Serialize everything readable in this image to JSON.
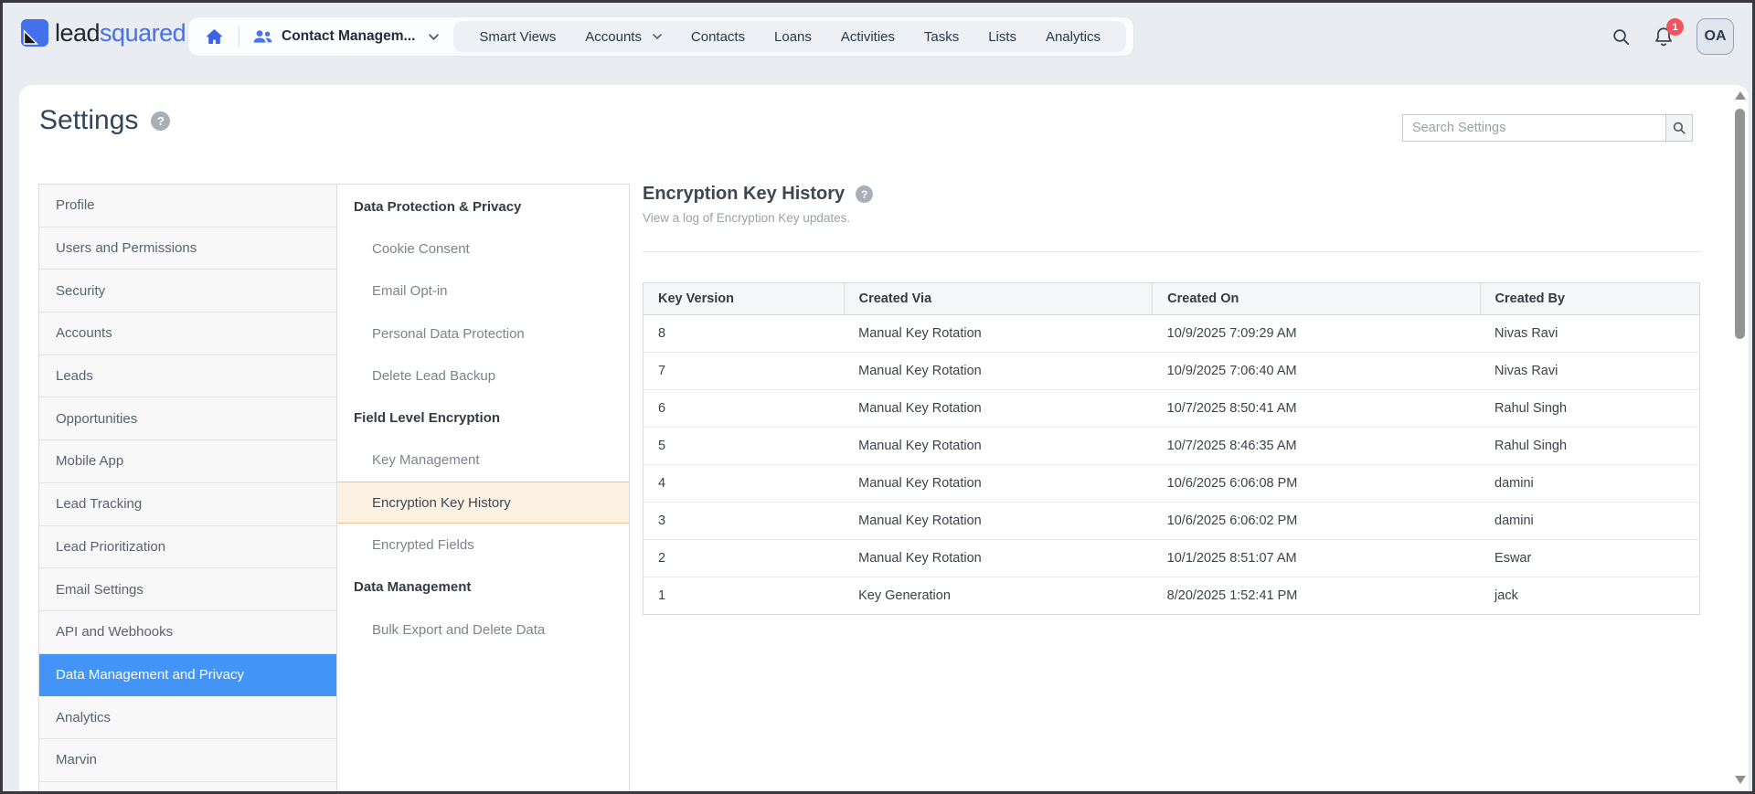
{
  "topbar": {
    "logo_lead": "lead",
    "logo_squared": "squared",
    "workspace_label": "Contact Managem...",
    "nav_items": [
      "Smart Views",
      "Accounts",
      "Contacts",
      "Loans",
      "Activities",
      "Tasks",
      "Lists",
      "Analytics"
    ],
    "nav_items_with_dropdown": [
      "Accounts"
    ],
    "notification_count": "1",
    "avatar_initials": "OA"
  },
  "icons": {
    "help_glyph": "?"
  },
  "page": {
    "title": "Settings",
    "search_placeholder": "Search Settings"
  },
  "sidebar": {
    "selected": "Data Management and Privacy",
    "items": [
      "Profile",
      "Users and Permissions",
      "Security",
      "Accounts",
      "Leads",
      "Opportunities",
      "Mobile App",
      "Lead Tracking",
      "Lead Prioritization",
      "Email Settings",
      "API and Webhooks",
      "Data Management and Privacy",
      "Analytics",
      "Marvin"
    ]
  },
  "subnav": {
    "selected": "Encryption Key History",
    "sections": [
      {
        "header": "Data Protection & Privacy",
        "items": [
          "Cookie Consent",
          "Email Opt-in",
          "Personal Data Protection",
          "Delete Lead Backup"
        ]
      },
      {
        "header": "Field Level Encryption",
        "items": [
          "Key Management",
          "Encryption Key History",
          "Encrypted Fields"
        ]
      },
      {
        "header": "Data Management",
        "items": [
          "Bulk Export and Delete Data"
        ]
      }
    ]
  },
  "content": {
    "title": "Encryption Key History",
    "subtitle": "View a log of Encryption Key updates.",
    "table": {
      "columns": [
        "Key Version",
        "Created Via",
        "Created On",
        "Created By"
      ],
      "rows": [
        [
          "8",
          "Manual Key Rotation",
          "10/9/2025 7:09:29 AM",
          "Nivas Ravi"
        ],
        [
          "7",
          "Manual Key Rotation",
          "10/9/2025 7:06:40 AM",
          "Nivas Ravi"
        ],
        [
          "6",
          "Manual Key Rotation",
          "10/7/2025 8:50:41 AM",
          "Rahul Singh"
        ],
        [
          "5",
          "Manual Key Rotation",
          "10/7/2025 8:46:35 AM",
          "Rahul Singh"
        ],
        [
          "4",
          "Manual Key Rotation",
          "10/6/2025 6:06:08 PM",
          "damini"
        ],
        [
          "3",
          "Manual Key Rotation",
          "10/6/2025 6:06:02 PM",
          "damini"
        ],
        [
          "2",
          "Manual Key Rotation",
          "10/1/2025 8:51:07 AM",
          "Eswar"
        ],
        [
          "1",
          "Key Generation",
          "8/20/2025 1:52:41 PM",
          "jack"
        ]
      ]
    }
  },
  "colors": {
    "brand_blue": "#4470eb",
    "selected_item_blue": "#4294f7",
    "selected_subnav_bg": "#fdf1e3",
    "selected_subnav_border": "#f0c08c",
    "notification_badge_red": "#f2545f",
    "topbar_bg": "#e9edf2"
  }
}
